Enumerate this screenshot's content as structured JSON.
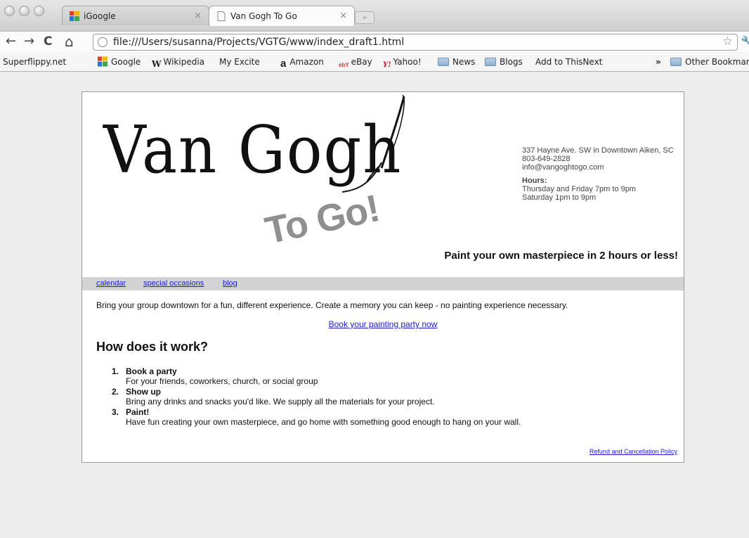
{
  "browser": {
    "tabs": [
      {
        "title": "iGoogle",
        "close": "×"
      },
      {
        "title": "Van Gogh To Go",
        "close": "×"
      }
    ],
    "nav": {
      "back": "←",
      "forward": "→",
      "reload": "C",
      "home": "⌂"
    },
    "url": "file:///Users/susanna/Projects/VGTG/www/index_draft1.html",
    "bookmarks": [
      {
        "label": "Superflippy.net",
        "icon": "page-icon"
      },
      {
        "label": "Google",
        "icon": "google-icon"
      },
      {
        "label": "Wikipedia",
        "icon": "wikipedia-icon",
        "glyph": "W"
      },
      {
        "label": "My Excite",
        "icon": "page-icon"
      },
      {
        "label": "Amazon",
        "icon": "amazon-icon",
        "glyph": "a"
      },
      {
        "label": "eBay",
        "icon": "ebay-icon",
        "glyph": "ebY"
      },
      {
        "label": "Yahoo!",
        "icon": "yahoo-icon",
        "glyph": "Y!"
      },
      {
        "label": "News",
        "icon": "folder-icon"
      },
      {
        "label": "Blogs",
        "icon": "folder-icon"
      },
      {
        "label": "Add to ThisNext",
        "icon": "page-icon"
      }
    ],
    "overflow": "»",
    "other_bookmarks": "Other Bookmarks"
  },
  "site": {
    "logo_main": "Van Gogh",
    "logo_sub": "To Go!",
    "contact": {
      "address": "337 Hayne Ave. SW in Downtown Aiken, SC",
      "phone": "803-649-2828",
      "email": "info@vangoghtogo.com",
      "hours_label": "Hours:",
      "hours_1": "Thursday and Friday 7pm to 9pm",
      "hours_2": "Saturday 1pm to 9pm"
    },
    "tagline": "Paint your own masterpiece in 2 hours or less!",
    "nav": [
      "calendar",
      "special occasions",
      "blog"
    ],
    "intro": "Bring your group downtown for a fun, different experience. Create a memory you can keep - no painting experience necessary.",
    "book_link": "Book your painting party now",
    "how_title": "How does it work?",
    "steps": [
      {
        "num": "1.",
        "title": "Book a party",
        "desc": "For your friends, coworkers, church, or social group"
      },
      {
        "num": "2.",
        "title": "Show up",
        "desc": "Bring any drinks and snacks you'd like. We supply all the materials for your project."
      },
      {
        "num": "3.",
        "title": "Paint!",
        "desc": "Have fun creating your own masterpiece, and go home with something good enough to hang on your wall."
      }
    ],
    "policy_link": "Refund and Cancellation Policy"
  },
  "colors": {
    "link": "#1a1ad6",
    "navbar": "#d3d3d3",
    "logo_grey": "#8f8f8f"
  }
}
